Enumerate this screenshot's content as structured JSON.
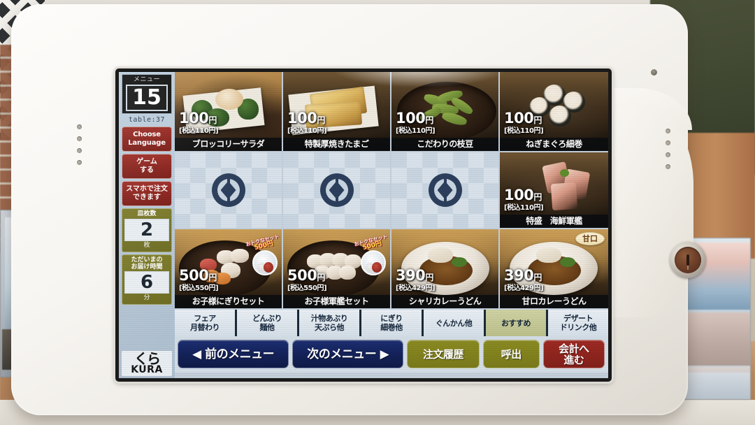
{
  "device": {
    "brand": "KURA",
    "lock_icon": "key-lock-icon",
    "camera_icon": "camera-hole-icon"
  },
  "sidebar": {
    "menu_caption": "メニュー",
    "menu_number": "15",
    "table_label": "table:37",
    "buttons": [
      {
        "label_line1": "Choose",
        "label_line2": "Language",
        "name": "choose-language-button"
      },
      {
        "label_line1": "ゲーム",
        "label_line2": "する",
        "name": "play-game-button"
      },
      {
        "label_line1": "スマホで注文",
        "label_line2": "できます",
        "name": "smartphone-order-button"
      }
    ],
    "plate_counter": {
      "caption": "皿枚数",
      "value": "2",
      "unit": "枚"
    },
    "delivery_timer": {
      "caption_line1": "ただいまの",
      "caption_line2": "お届け時間",
      "value": "6",
      "unit": "分"
    },
    "logo_jp": "くら",
    "logo_en": "KURA"
  },
  "items": [
    {
      "name": "ブロッコリーサラダ",
      "price": "100",
      "yen": "円",
      "tax": "[税込110円]",
      "style": "wood",
      "kind": "broccoli",
      "empty": false,
      "badge": null
    },
    {
      "name": "特製厚焼きたまご",
      "price": "100",
      "yen": "円",
      "tax": "[税込110円]",
      "style": "dark",
      "kind": "tamago",
      "empty": false,
      "badge": null
    },
    {
      "name": "こだわりの枝豆",
      "price": "100",
      "yen": "円",
      "tax": "[税込110円]",
      "style": "dark",
      "kind": "edamame",
      "empty": false,
      "badge": null
    },
    {
      "name": "ねぎまぐろ細巻",
      "price": "100",
      "yen": "円",
      "tax": "[税込110円]",
      "style": "dark",
      "kind": "maki",
      "empty": false,
      "badge": null
    },
    {
      "name": "",
      "price": "",
      "yen": "",
      "tax": "",
      "style": "",
      "kind": "logo",
      "empty": true,
      "badge": null
    },
    {
      "name": "",
      "price": "",
      "yen": "",
      "tax": "",
      "style": "",
      "kind": "logo",
      "empty": true,
      "badge": null
    },
    {
      "name": "",
      "price": "",
      "yen": "",
      "tax": "",
      "style": "",
      "kind": "logo",
      "empty": true,
      "badge": null
    },
    {
      "name": "特盛　海鮮軍艦",
      "price": "100",
      "yen": "円",
      "tax": "[税込110円]",
      "style": "dark",
      "kind": "gunkan",
      "empty": false,
      "badge": null
    },
    {
      "name": "お子様にぎりセット",
      "price": "500",
      "yen": "円",
      "tax": "[税込550円]",
      "style": "gold",
      "kind": "kids-nigiri",
      "empty": false,
      "badge": "set"
    },
    {
      "name": "お子様軍艦セット",
      "price": "500",
      "yen": "円",
      "tax": "[税込550円]",
      "style": "gold",
      "kind": "kids-gunkan",
      "empty": false,
      "badge": "set"
    },
    {
      "name": "シャリカレーうどん",
      "price": "390",
      "yen": "円",
      "tax": "[税込429円]",
      "style": "gold",
      "kind": "curry-udon",
      "empty": false,
      "badge": null
    },
    {
      "name": "甘ロカレーうどん",
      "price": "390",
      "yen": "円",
      "tax": "[税込429円]",
      "style": "gold",
      "kind": "curry-udon",
      "empty": false,
      "badge": "甘口"
    }
  ],
  "set_ribbon": {
    "line1": "おトクなセット",
    "line2": "500円"
  },
  "tabs": [
    {
      "line1": "フェア",
      "line2": "月替わり",
      "active": false
    },
    {
      "line1": "どんぶり",
      "line2": "麺他",
      "active": false
    },
    {
      "line1": "汁物あぶり",
      "line2": "天ぷら他",
      "active": false
    },
    {
      "line1": "にぎり",
      "line2": "細巻他",
      "active": false
    },
    {
      "line1": "ぐんかん他",
      "line2": "",
      "active": false
    },
    {
      "line1": "おすすめ",
      "line2": "",
      "active": true
    },
    {
      "line1": "デザート",
      "line2": "ドリンク他",
      "active": false
    }
  ],
  "bottom_buttons": [
    {
      "label": "◀ 前のメニュー",
      "kind": "nav",
      "name": "previous-menu-button"
    },
    {
      "label": "次のメニュー ▶",
      "kind": "nav",
      "name": "next-menu-button"
    },
    {
      "label": "注文履歴",
      "kind": "olive",
      "name": "order-history-button"
    },
    {
      "label": "呼出",
      "kind": "olive-small",
      "name": "call-staff-button"
    },
    {
      "label_line1": "会計へ",
      "label_line2": "進む",
      "kind": "red",
      "name": "checkout-button"
    }
  ],
  "colors": {
    "accent_red": "#8a201a",
    "accent_olive": "#7a7a1b",
    "accent_navy": "#14225a",
    "screen_bg": "#d9e2ea",
    "tab_active": "#bcc08c"
  }
}
